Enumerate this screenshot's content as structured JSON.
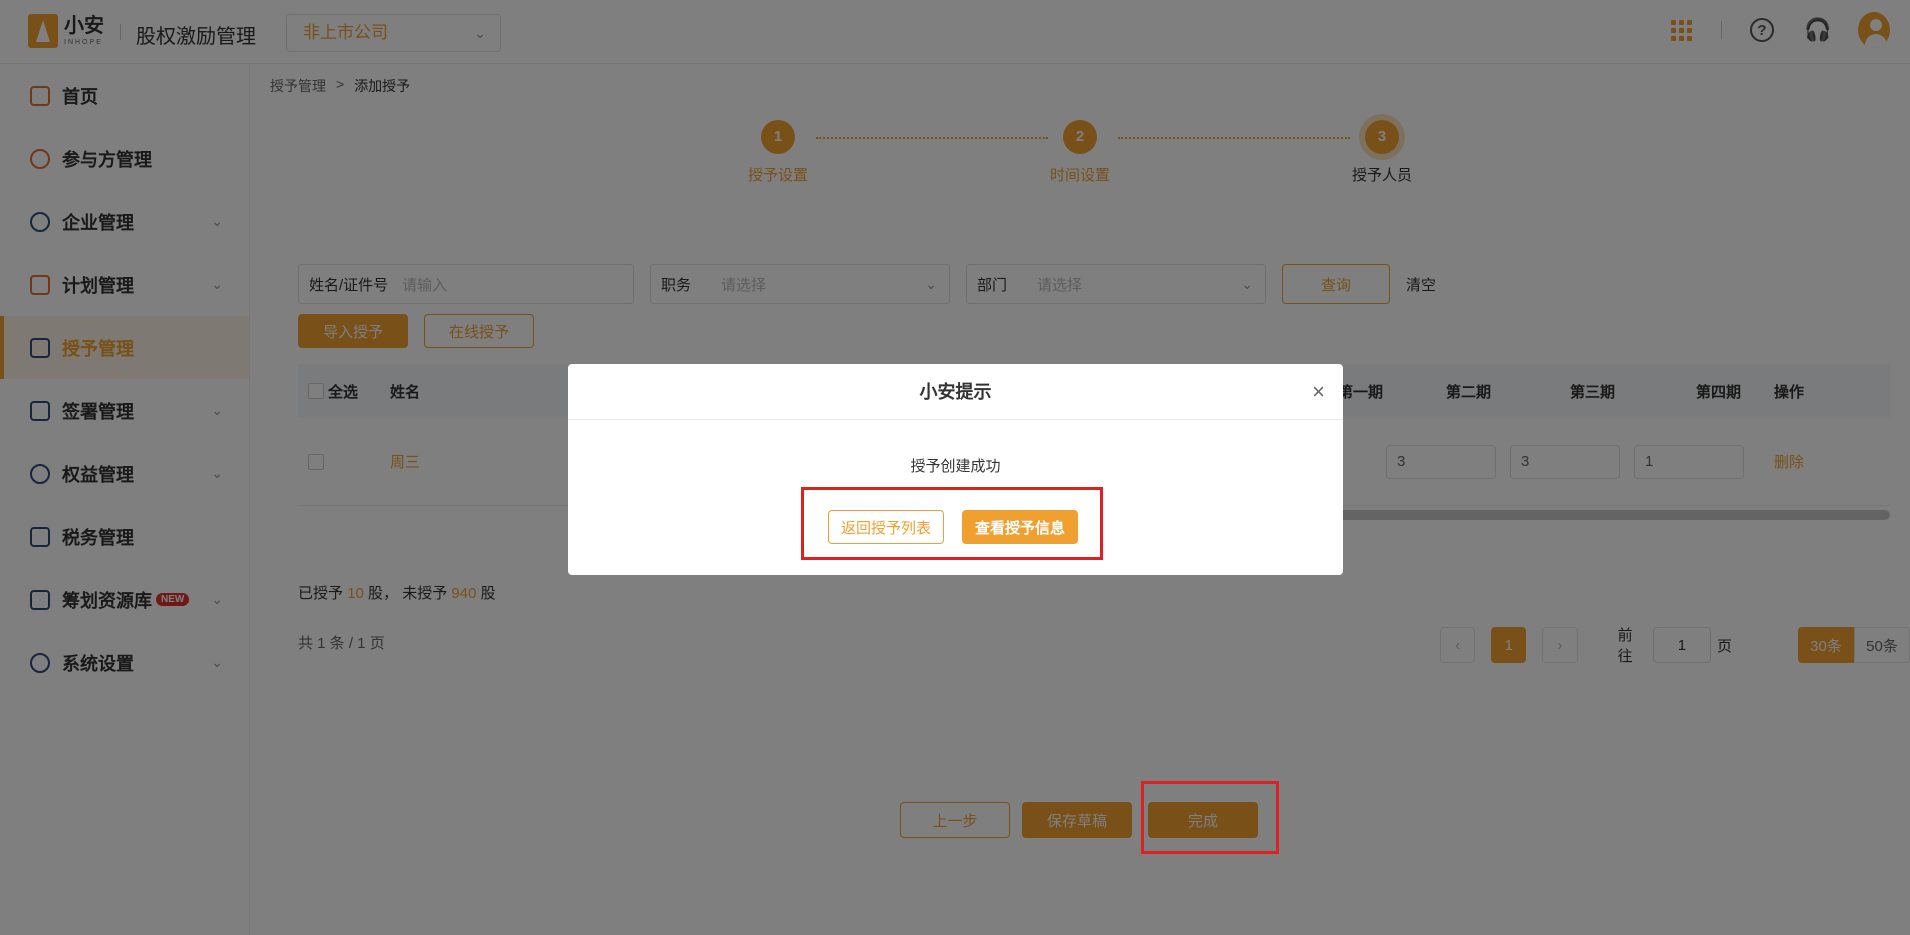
{
  "header": {
    "logo_text": "小安",
    "logo_sub": "INHOPE",
    "app_title": "股权激励管理",
    "company_select": "非上市公司",
    "help_glyph": "?"
  },
  "sidebar": {
    "items": [
      {
        "label": "首页",
        "icon": "home-icon"
      },
      {
        "label": "参与方管理",
        "icon": "users-icon"
      },
      {
        "label": "企业管理",
        "icon": "enterprise-icon"
      },
      {
        "label": "计划管理",
        "icon": "plan-icon"
      },
      {
        "label": "授予管理",
        "icon": "grant-icon"
      },
      {
        "label": "签署管理",
        "icon": "sign-icon"
      },
      {
        "label": "权益管理",
        "icon": "equity-icon"
      },
      {
        "label": "税务管理",
        "icon": "tax-icon"
      },
      {
        "label": "筹划资源库",
        "icon": "layers-icon",
        "badge": "NEW"
      },
      {
        "label": "系统设置",
        "icon": "settings-icon"
      }
    ]
  },
  "breadcrumb": {
    "parent": "授予管理",
    "separator": ">",
    "current": "添加授予"
  },
  "steps": [
    {
      "num": "1",
      "label": "授予设置"
    },
    {
      "num": "2",
      "label": "时间设置"
    },
    {
      "num": "3",
      "label": "授予人员"
    }
  ],
  "filters": {
    "name_label": "姓名/证件号",
    "name_placeholder": "请输入",
    "position_label": "职务",
    "position_placeholder": "请选择",
    "dept_label": "部门",
    "dept_placeholder": "请选择",
    "query_btn": "查询",
    "clear_btn": "清空"
  },
  "actions": {
    "import_btn": "导入授予",
    "online_btn": "在线授予"
  },
  "table": {
    "headers": {
      "select_all": "全选",
      "name": "姓名",
      "p1": "第一期",
      "p2": "第二期",
      "p3": "第三期",
      "p4": "第四期",
      "op": "操作"
    },
    "rows": [
      {
        "name": "周三",
        "p2": "3",
        "p3": "3",
        "p4": "1",
        "op": "删除"
      }
    ]
  },
  "summary": {
    "granted_prefix": "已授予",
    "granted": "10",
    "mid": "股，  未授予",
    "ungranted": "940",
    "suffix": "股"
  },
  "total": "共 1 条 / 1 页",
  "pager": {
    "current": "1",
    "goto_label": "前往",
    "goto_value": "1",
    "page_unit": "页",
    "size_on": "30条",
    "size_off": "50条",
    "prev": "‹",
    "next": "›"
  },
  "footer": {
    "prev": "上一步",
    "save": "保存草稿",
    "done": "完成"
  },
  "modal": {
    "title": "小安提示",
    "message": "授予创建成功",
    "back_btn": "返回授予列表",
    "view_btn": "查看授予信息",
    "close": "×"
  },
  "colors": {
    "accent": "#f0a030",
    "highlight": "#e02020"
  }
}
